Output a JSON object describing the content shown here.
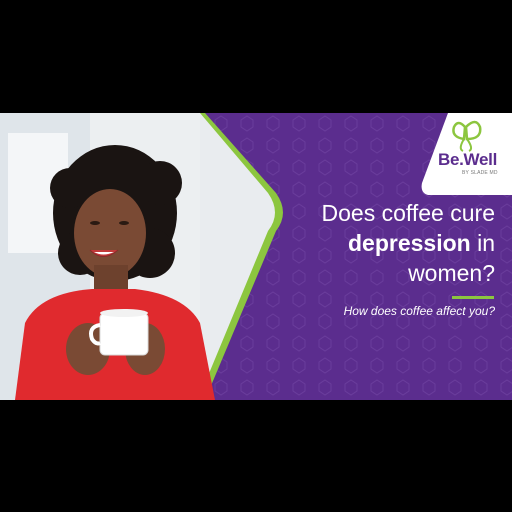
{
  "logo": {
    "name": "Be.Well",
    "sub": "BY SLADE MD"
  },
  "headline": {
    "line1": "Does coffee cure",
    "bold": "depression",
    "line2_rest": " in",
    "line3": "women?"
  },
  "subtitle": "How does coffee affect you?",
  "colors": {
    "brand_purple": "#5b2d8e",
    "accent_green": "#8cc63f",
    "shirt_red": "#e02a2e"
  }
}
